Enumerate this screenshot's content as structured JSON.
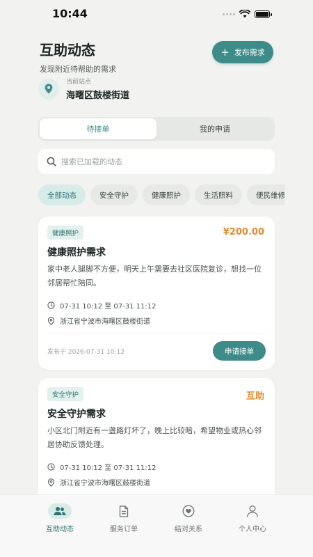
{
  "status_bar": {
    "time": "10:44"
  },
  "header": {
    "title": "互助动态",
    "subtitle": "发现附近待帮助的需求",
    "publish_label": "发布需求"
  },
  "location": {
    "label": "当前站点",
    "value": "海曙区鼓楼街道"
  },
  "segment": {
    "tabs": [
      "待接单",
      "我的申请"
    ],
    "active": "待接单"
  },
  "search": {
    "placeholder": "搜索已加载的动态",
    "value": ""
  },
  "chips": [
    "全部动态",
    "安全守护",
    "健康照护",
    "生活照料",
    "便民维修"
  ],
  "cards": [
    {
      "tag": "健康照护",
      "price": "¥200.00",
      "title": "健康照护需求",
      "description": "家中老人腿脚不方便，明天上午需要去社区医院复诊，想找一位邻居帮忙陪同。",
      "time_range": "07-31 10:12 至 07-31 11:12",
      "address": "浙江省宁波市海曙区鼓楼街道",
      "published": "发布于 2026-07-31 10:12",
      "action": "申请接单"
    },
    {
      "tag": "安全守护",
      "price": "互助",
      "title": "安全守护需求",
      "description": "小区北门附近有一盏路灯坏了，晚上比较暗，希望物业或热心邻居协助反馈处理。",
      "time_range": "07-31 10:12 至 07-31 11:12",
      "address": "浙江省宁波市海曙区鼓楼街道"
    }
  ],
  "bottom_nav": [
    {
      "label": "互助动态",
      "icon": "people-icon",
      "active": true
    },
    {
      "label": "服务订单",
      "icon": "document-icon",
      "active": false
    },
    {
      "label": "结对关系",
      "icon": "heart-badge-icon",
      "active": false
    },
    {
      "label": "个人中心",
      "icon": "user-icon",
      "active": false
    }
  ],
  "colors": {
    "accent": "#3d8c8a",
    "price": "#e48a2d",
    "background": "#f2f3f1"
  }
}
